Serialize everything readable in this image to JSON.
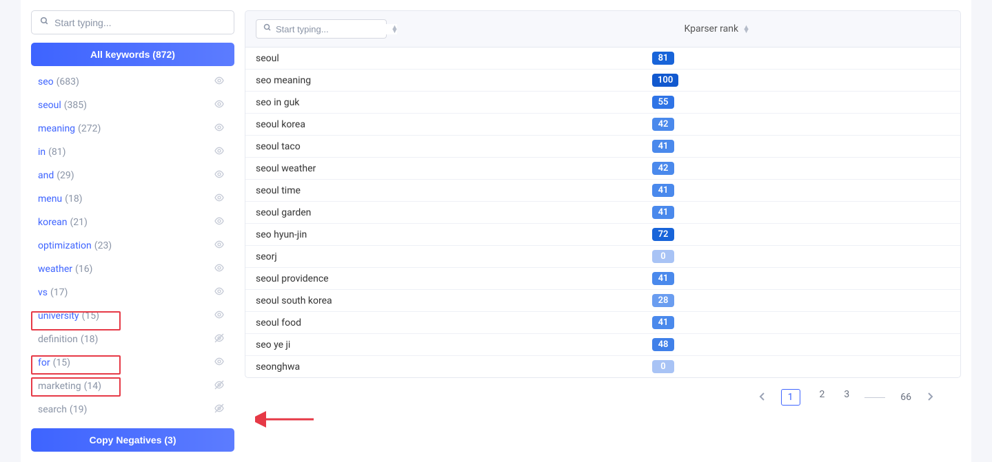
{
  "sidebar": {
    "search_placeholder": "Start typing...",
    "all_keywords_label": "All keywords (872)",
    "items": [
      {
        "name": "seo",
        "count": "(683)",
        "hidden": false
      },
      {
        "name": "seoul",
        "count": "(385)",
        "hidden": false
      },
      {
        "name": "meaning",
        "count": "(272)",
        "hidden": false
      },
      {
        "name": "in",
        "count": "(81)",
        "hidden": false
      },
      {
        "name": "and",
        "count": "(29)",
        "hidden": false
      },
      {
        "name": "menu",
        "count": "(18)",
        "hidden": false
      },
      {
        "name": "korean",
        "count": "(21)",
        "hidden": false
      },
      {
        "name": "optimization",
        "count": "(23)",
        "hidden": false
      },
      {
        "name": "weather",
        "count": "(16)",
        "hidden": false
      },
      {
        "name": "vs",
        "count": "(17)",
        "hidden": false
      },
      {
        "name": "university",
        "count": "(15)",
        "hidden": false
      },
      {
        "name": "definition",
        "count": "(18)",
        "hidden": true
      },
      {
        "name": "for",
        "count": "(15)",
        "hidden": false
      },
      {
        "name": "marketing",
        "count": "(14)",
        "hidden": true
      },
      {
        "name": "search",
        "count": "(19)",
        "hidden": true
      }
    ],
    "copy_negatives_label": "Copy Negatives (3)"
  },
  "main": {
    "search_placeholder": "Start typing...",
    "rank_header": "Kparser rank",
    "rows": [
      {
        "keyword": "seoul",
        "rank": "81",
        "color": "#1864d9"
      },
      {
        "keyword": "seo meaning",
        "rank": "100",
        "color": "#1259cf"
      },
      {
        "keyword": "seo in guk",
        "rank": "55",
        "color": "#2f74e6"
      },
      {
        "keyword": "seoul korea",
        "rank": "42",
        "color": "#4a89ec"
      },
      {
        "keyword": "seoul taco",
        "rank": "41",
        "color": "#4a89ec"
      },
      {
        "keyword": "seoul weather",
        "rank": "42",
        "color": "#4a89ec"
      },
      {
        "keyword": "seoul time",
        "rank": "41",
        "color": "#4a89ec"
      },
      {
        "keyword": "seoul garden",
        "rank": "41",
        "color": "#4a89ec"
      },
      {
        "keyword": "seo hyun-jin",
        "rank": "72",
        "color": "#1864d9"
      },
      {
        "keyword": "seorj",
        "rank": "0",
        "color": "#a8c3f5"
      },
      {
        "keyword": "seoul providence",
        "rank": "41",
        "color": "#4a89ec"
      },
      {
        "keyword": "seoul south korea",
        "rank": "28",
        "color": "#6a9df0"
      },
      {
        "keyword": "seoul food",
        "rank": "41",
        "color": "#4a89ec"
      },
      {
        "keyword": "seo ye ji",
        "rank": "48",
        "color": "#4080e9"
      },
      {
        "keyword": "seonghwa",
        "rank": "0",
        "color": "#a8c3f5"
      }
    ],
    "pagination": {
      "pages": [
        "1",
        "2",
        "3"
      ],
      "last": "66",
      "active": "1"
    }
  }
}
